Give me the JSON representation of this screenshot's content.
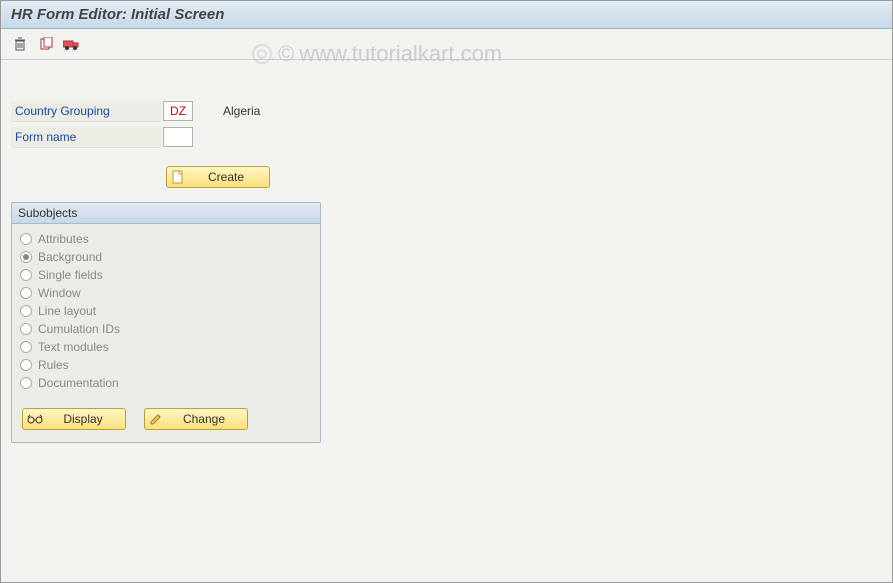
{
  "titleBar": {
    "text": "HR Form Editor: Initial Screen"
  },
  "toolbar": {
    "icons": [
      "trash",
      "copy",
      "transport"
    ]
  },
  "watermark": {
    "text": "www.tutorialkart.com",
    "copyright": "©"
  },
  "fields": {
    "countryGrouping": {
      "label": "Country Grouping",
      "value": "DZ",
      "desc": "Algeria"
    },
    "formName": {
      "label": "Form name",
      "value": ""
    }
  },
  "createButton": {
    "label": "Create"
  },
  "groupBox": {
    "title": "Subobjects",
    "radios": [
      {
        "label": "Attributes",
        "checked": false
      },
      {
        "label": "Background",
        "checked": true
      },
      {
        "label": "Single fields",
        "checked": false
      },
      {
        "label": "Window",
        "checked": false
      },
      {
        "label": "Line layout",
        "checked": false
      },
      {
        "label": "Cumulation IDs",
        "checked": false
      },
      {
        "label": "Text modules",
        "checked": false
      },
      {
        "label": "Rules",
        "checked": false
      },
      {
        "label": "Documentation",
        "checked": false
      }
    ],
    "buttons": {
      "display": "Display",
      "change": "Change"
    }
  }
}
